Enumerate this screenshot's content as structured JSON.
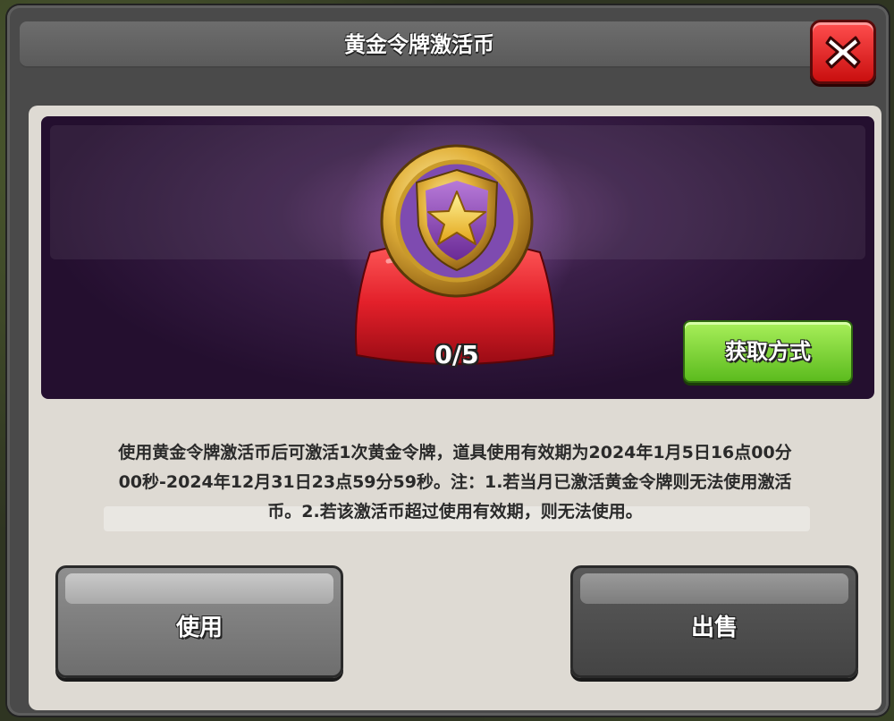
{
  "dialog": {
    "title": "黄金令牌激活币",
    "close_label": "X"
  },
  "item": {
    "count": "0/5",
    "get_button": "获取方式"
  },
  "description": {
    "line1": "使用黄金令牌激活币后可激活1次黄金令牌，道具使用有效期为2024年1月5日16点00分",
    "line2": "00秒-2024年12月31日23点59分59秒。注：1.若当月已激活黄金令牌则无法使用激活",
    "line3": "币。2.若该激活币超过使用有效期，则无法使用。"
  },
  "actions": {
    "use_label": "使用",
    "sell_label": "出售"
  },
  "colors": {
    "close_red": "#e21b1b",
    "get_green": "#6cc52a",
    "banner_purple": "#3a1f48"
  }
}
